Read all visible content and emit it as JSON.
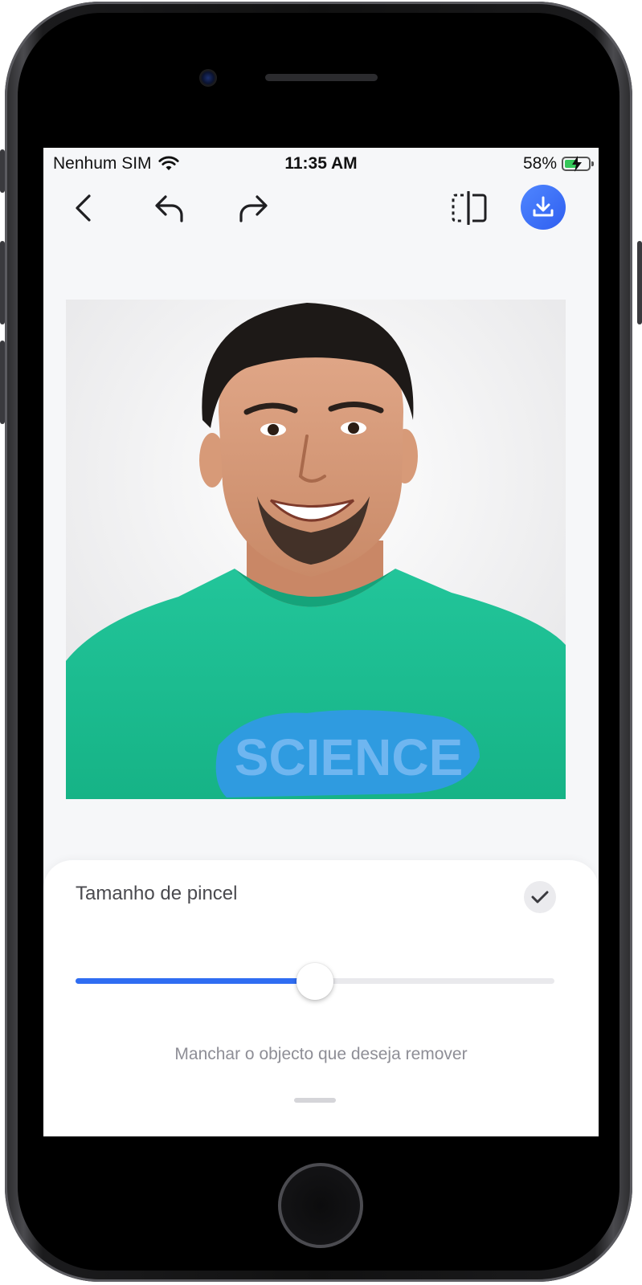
{
  "status_bar": {
    "carrier": "Nenhum SIM",
    "time": "11:35 AM",
    "battery": "58%",
    "battery_level": 0.58
  },
  "toolbar": {
    "back_icon": "chevron-left-icon",
    "undo_icon": "undo-icon",
    "redo_icon": "redo-icon",
    "compare_icon": "compare-split-icon",
    "download_icon": "download-icon",
    "accent": "#2f6df2"
  },
  "sheet": {
    "title": "Tamanho de pincel",
    "confirm_icon": "checkmark-icon",
    "brush_size": 0.5,
    "hint": "Manchar o objecto que deseja remover"
  },
  "photo": {
    "shirt_text": "SCIENCE"
  }
}
